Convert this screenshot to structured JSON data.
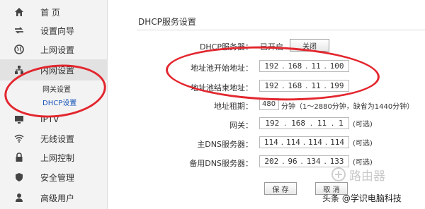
{
  "sidebar": {
    "items": [
      {
        "label": "首 页",
        "icon": "home-icon"
      },
      {
        "label": "设置向导",
        "icon": "wizard-arrows-icon"
      },
      {
        "label": "上网设置",
        "icon": "globe-icon"
      },
      {
        "label": "内网设置",
        "icon": "lan-icon"
      },
      {
        "label": "IPTV",
        "icon": "tv-icon"
      },
      {
        "label": "无线设置",
        "icon": "wifi-icon"
      },
      {
        "label": "上网控制",
        "icon": "lock-icon"
      },
      {
        "label": "安全管理",
        "icon": "shield-icon"
      },
      {
        "label": "高级用户",
        "icon": "user-icon"
      }
    ],
    "sub_items": [
      {
        "label": "网关设置"
      },
      {
        "label": "DHCP设置"
      }
    ]
  },
  "dhcp": {
    "title": "DHCP服务设置",
    "server": {
      "label": "DHCP服务器：",
      "status": "已开启",
      "toggle_button": "关闭"
    },
    "start": {
      "label": "地址池开始地址：",
      "ip": [
        "192",
        "168",
        "11",
        "100"
      ]
    },
    "end": {
      "label": "地址池结束地址：",
      "ip": [
        "192",
        "168",
        "11",
        "199"
      ]
    },
    "lease": {
      "label": "地址租期：",
      "value": "480",
      "hint": "分钟（1～2880分钟，缺省为1440分钟）"
    },
    "gateway": {
      "label": "网关：",
      "ip": [
        "192",
        "168",
        "11",
        "1"
      ],
      "note": "(可选)"
    },
    "dns1": {
      "label": "主DNS服务器：",
      "ip": [
        "114",
        "114",
        "114",
        "114"
      ],
      "note": "(可选)"
    },
    "dns2": {
      "label": "备用DNS服务器：",
      "ip": [
        "202",
        "96",
        "134",
        "133"
      ],
      "note": "(可选)"
    },
    "save_button": "保 存",
    "cancel_button": "取 消"
  },
  "watermark": {
    "logo_text": "路由器",
    "caption": "头条 @学识电脑科技"
  },
  "colors": {
    "annotation": "#e3262e",
    "link_active": "#1a56b8"
  }
}
